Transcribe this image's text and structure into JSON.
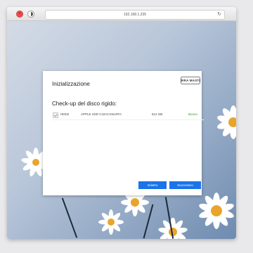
{
  "browser": {
    "url": "192.168.1.235",
    "close_icon": "×"
  },
  "dialog": {
    "title": "Inizializzazione",
    "logo_text": "TERRA MASTER",
    "subtitle": "Check-up del disco rigido:",
    "disks": [
      {
        "checked": true,
        "name": "HDD2",
        "model": "APPLE SSD C42ACXNA9TA",
        "size": "512 GB",
        "status": "Buono"
      }
    ],
    "back_button": "Indietro",
    "next_button": "Successivo"
  },
  "colors": {
    "accent": "#1a73e8",
    "status_good": "#2e9a2e",
    "close_red": "#ec4d4a"
  }
}
